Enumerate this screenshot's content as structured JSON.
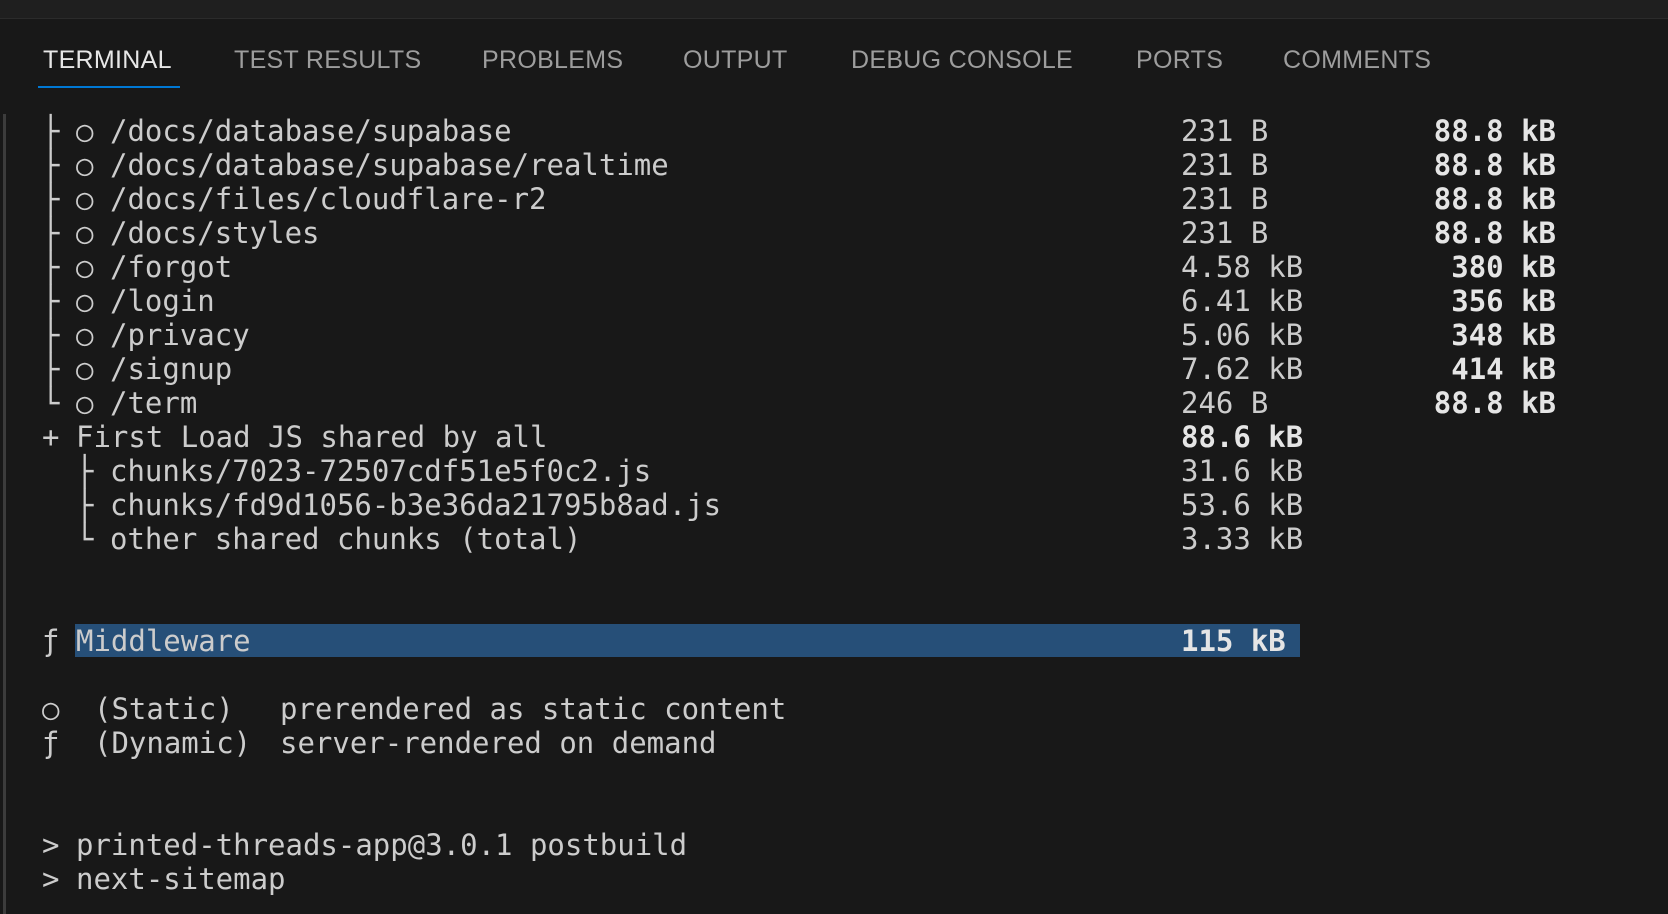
{
  "tabs": [
    {
      "label": "TERMINAL"
    },
    {
      "label": "TEST RESULTS"
    },
    {
      "label": "PROBLEMS"
    },
    {
      "label": "OUTPUT"
    },
    {
      "label": "DEBUG CONSOLE"
    },
    {
      "label": "PORTS"
    },
    {
      "label": "COMMENTS"
    }
  ],
  "active_tab": "TERMINAL",
  "routes": [
    {
      "tree": "├",
      "marker": "○",
      "path": "/docs/database/supabase",
      "size": "231 B",
      "first_load": "88.8 kB"
    },
    {
      "tree": "├",
      "marker": "○",
      "path": "/docs/database/supabase/realtime",
      "size": "231 B",
      "first_load": "88.8 kB"
    },
    {
      "tree": "├",
      "marker": "○",
      "path": "/docs/files/cloudflare-r2",
      "size": "231 B",
      "first_load": "88.8 kB"
    },
    {
      "tree": "├",
      "marker": "○",
      "path": "/docs/styles",
      "size": "231 B",
      "first_load": "88.8 kB"
    },
    {
      "tree": "├",
      "marker": "○",
      "path": "/forgot",
      "size": "4.58 kB",
      "first_load": "380 kB"
    },
    {
      "tree": "├",
      "marker": "○",
      "path": "/login",
      "size": "6.41 kB",
      "first_load": "356 kB"
    },
    {
      "tree": "├",
      "marker": "○",
      "path": "/privacy",
      "size": "5.06 kB",
      "first_load": "348 kB"
    },
    {
      "tree": "├",
      "marker": "○",
      "path": "/signup",
      "size": "7.62 kB",
      "first_load": "414 kB"
    },
    {
      "tree": "└",
      "marker": "○",
      "path": "/term",
      "size": "246 B",
      "first_load": "88.8 kB"
    }
  ],
  "shared": {
    "prefix": "+",
    "label": "First Load JS shared by all",
    "size": "88.6 kB",
    "chunks": [
      {
        "tree": "├",
        "name": "chunks/7023-72507cdf51e5f0c2.js",
        "size": "31.6 kB"
      },
      {
        "tree": "├",
        "name": "chunks/fd9d1056-b3e36da21795b8ad.js",
        "size": "53.6 kB"
      },
      {
        "tree": "└",
        "name": "other shared chunks (total)",
        "size": "3.33 kB"
      }
    ]
  },
  "middleware": {
    "marker": "ƒ",
    "label": "Middleware",
    "size": "115 kB"
  },
  "legend": [
    {
      "marker": "○",
      "kind": "(Static)",
      "desc": "prerendered as static content"
    },
    {
      "marker": "ƒ",
      "kind": "(Dynamic)",
      "desc": "server-rendered on demand"
    }
  ],
  "commands": [
    {
      "prompt": ">",
      "text": "printed-threads-app@3.0.1 postbuild"
    },
    {
      "prompt": ">",
      "text": "next-sitemap"
    }
  ],
  "colors": {
    "background": "#181818",
    "selection": "#264f78",
    "tab_underline": "#0078d4"
  }
}
